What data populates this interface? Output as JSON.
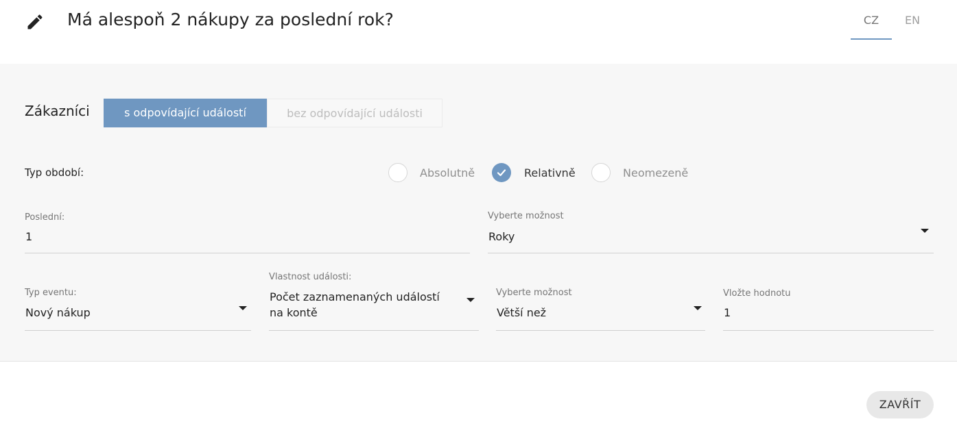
{
  "header": {
    "edit_icon": "pencil-icon",
    "title": "Má alespoň 2 nákupy za poslední rok?",
    "languages": [
      {
        "code": "CZ",
        "active": true
      },
      {
        "code": "EN",
        "active": false
      }
    ]
  },
  "customers": {
    "label": "Zákazníci",
    "options": [
      "s odpovídající událostí",
      "bez odpovídající události"
    ],
    "selected": "s odpovídající událostí"
  },
  "period": {
    "label": "Typ období:",
    "options": [
      {
        "label": "Absolutně",
        "checked": false
      },
      {
        "label": "Relativně",
        "checked": true
      },
      {
        "label": "Neomezeně",
        "checked": false
      }
    ]
  },
  "last_field": {
    "label": "Poslední:",
    "value": "1"
  },
  "unit_field": {
    "label": "Vyberte možnost",
    "value": "Roky"
  },
  "event_type_field": {
    "label": "Typ eventu:",
    "value": "Nový nákup"
  },
  "event_property_field": {
    "label": "Vlastnost události:",
    "value_line1": "Počet zaznamenaných událostí",
    "value_line2": "na kontě"
  },
  "operator_field": {
    "label": "Vyberte možnost",
    "value": "Větší než"
  },
  "value_field": {
    "label": "Vložte hodnotu",
    "value": "1"
  },
  "footer": {
    "close_label": "ZAVŘÍT"
  },
  "colors": {
    "accent": "#6f97c1",
    "panel_bg": "#f7f7f7"
  }
}
